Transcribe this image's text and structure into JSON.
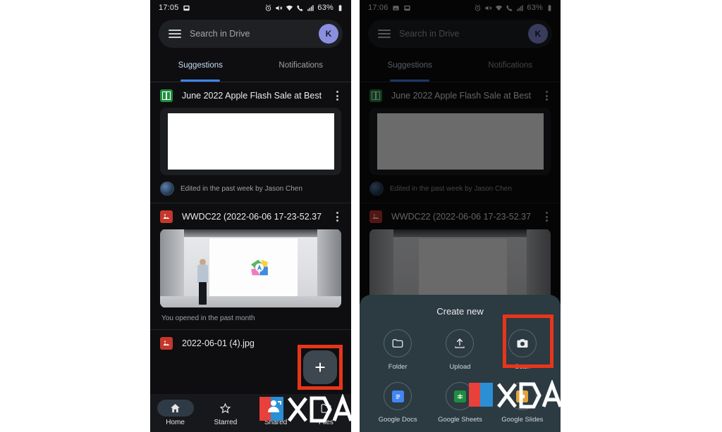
{
  "left_phone": {
    "status_bar": {
      "time": "17:05",
      "left_icons": [
        "screenshot-icon"
      ],
      "right_icons": [
        "alarm-icon",
        "mute-icon",
        "wifi-icon",
        "call-icon",
        "signal-icon"
      ],
      "battery_percent": "63%"
    },
    "search": {
      "placeholder": "Search in Drive",
      "avatar_initial": "K",
      "menu_icon": "hamburger-icon"
    },
    "tabs": [
      {
        "label": "Suggestions",
        "active": true
      },
      {
        "label": "Notifications",
        "active": false
      }
    ],
    "feed": [
      {
        "title": "June 2022 Apple Flash Sale at Best...",
        "file_type": "sheets",
        "footer": "Edited in the past week by Jason Chen"
      },
      {
        "title": "WWDC22 (2022-06-06 17-23-52.37...",
        "file_type": "image",
        "footer": "You opened in the past month"
      },
      {
        "title": "2022-06-01 (4).jpg",
        "file_type": "image",
        "footer": ""
      }
    ],
    "fab": {
      "label": "Create new",
      "icon": "plus-icon"
    },
    "bottom_nav": [
      {
        "label": "Home",
        "icon": "home-icon",
        "active": true
      },
      {
        "label": "Starred",
        "icon": "star-icon",
        "active": false
      },
      {
        "label": "Shared",
        "icon": "shared-people-icon",
        "active": false
      },
      {
        "label": "Files",
        "icon": "files-icon",
        "active": false
      }
    ]
  },
  "right_phone": {
    "status_bar": {
      "time": "17:06",
      "left_icons": [
        "gallery-icon",
        "screenshot-icon"
      ],
      "right_icons": [
        "alarm-icon",
        "mute-icon",
        "wifi-icon",
        "call-icon",
        "signal-icon"
      ],
      "battery_percent": "63%"
    },
    "search": {
      "placeholder": "Search in Drive",
      "avatar_initial": "K",
      "menu_icon": "hamburger-icon"
    },
    "tabs": [
      {
        "label": "Suggestions",
        "active": true
      },
      {
        "label": "Notifications",
        "active": false
      }
    ],
    "feed": [
      {
        "title": "June 2022 Apple Flash Sale at Best...",
        "file_type": "sheets",
        "footer": "Edited in the past week by Jason Chen"
      },
      {
        "title": "WWDC22 (2022-06-06 17-23-52.37...",
        "file_type": "image",
        "footer": ""
      }
    ],
    "sheet": {
      "title": "Create new",
      "items": [
        {
          "label": "Folder",
          "icon": "folder-icon"
        },
        {
          "label": "Upload",
          "icon": "upload-icon"
        },
        {
          "label": "Scan",
          "icon": "scan-camera-icon",
          "highlighted": true
        },
        {
          "label": "Google Docs",
          "icon": "google-docs-icon"
        },
        {
          "label": "Google Sheets",
          "icon": "google-sheets-icon"
        },
        {
          "label": "Google Slides",
          "icon": "google-slides-icon"
        }
      ]
    }
  },
  "annotations": {
    "highlight_color": "#e8351a",
    "boxes": [
      {
        "target": "fab-create-new",
        "phone": "left"
      },
      {
        "target": "sheet-item-scan",
        "phone": "right"
      }
    ]
  },
  "watermark": {
    "text": "XDA"
  }
}
